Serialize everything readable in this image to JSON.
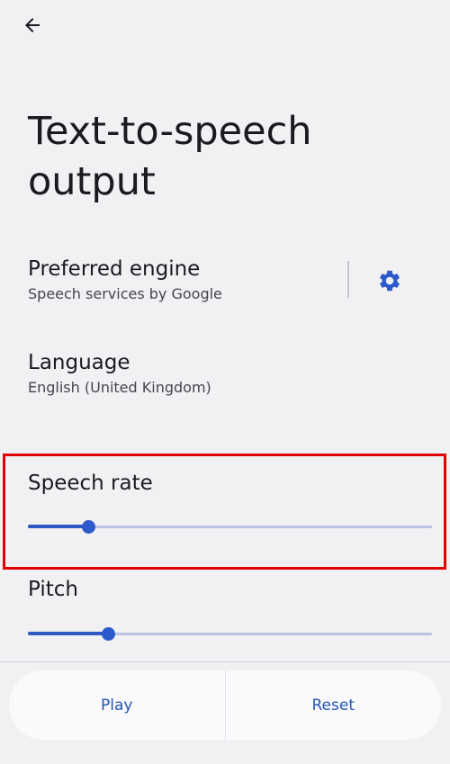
{
  "header": {
    "back_icon": "arrow-back-icon"
  },
  "page": {
    "title": "Text-to-speech output"
  },
  "preferred_engine": {
    "title": "Preferred engine",
    "subtitle": "Speech services by Google",
    "settings_icon": "gear-icon"
  },
  "language": {
    "title": "Language",
    "subtitle": "English (United Kingdom)"
  },
  "speech_rate": {
    "label": "Speech rate",
    "value_fraction": 0.15
  },
  "pitch": {
    "label": "Pitch",
    "value_fraction": 0.2
  },
  "actions": {
    "play_label": "Play",
    "reset_label": "Reset"
  },
  "colors": {
    "background": "#f1f1f3",
    "accent": "#2c59cc",
    "track_inactive": "#b7c4e4",
    "highlight": "#e00000"
  }
}
